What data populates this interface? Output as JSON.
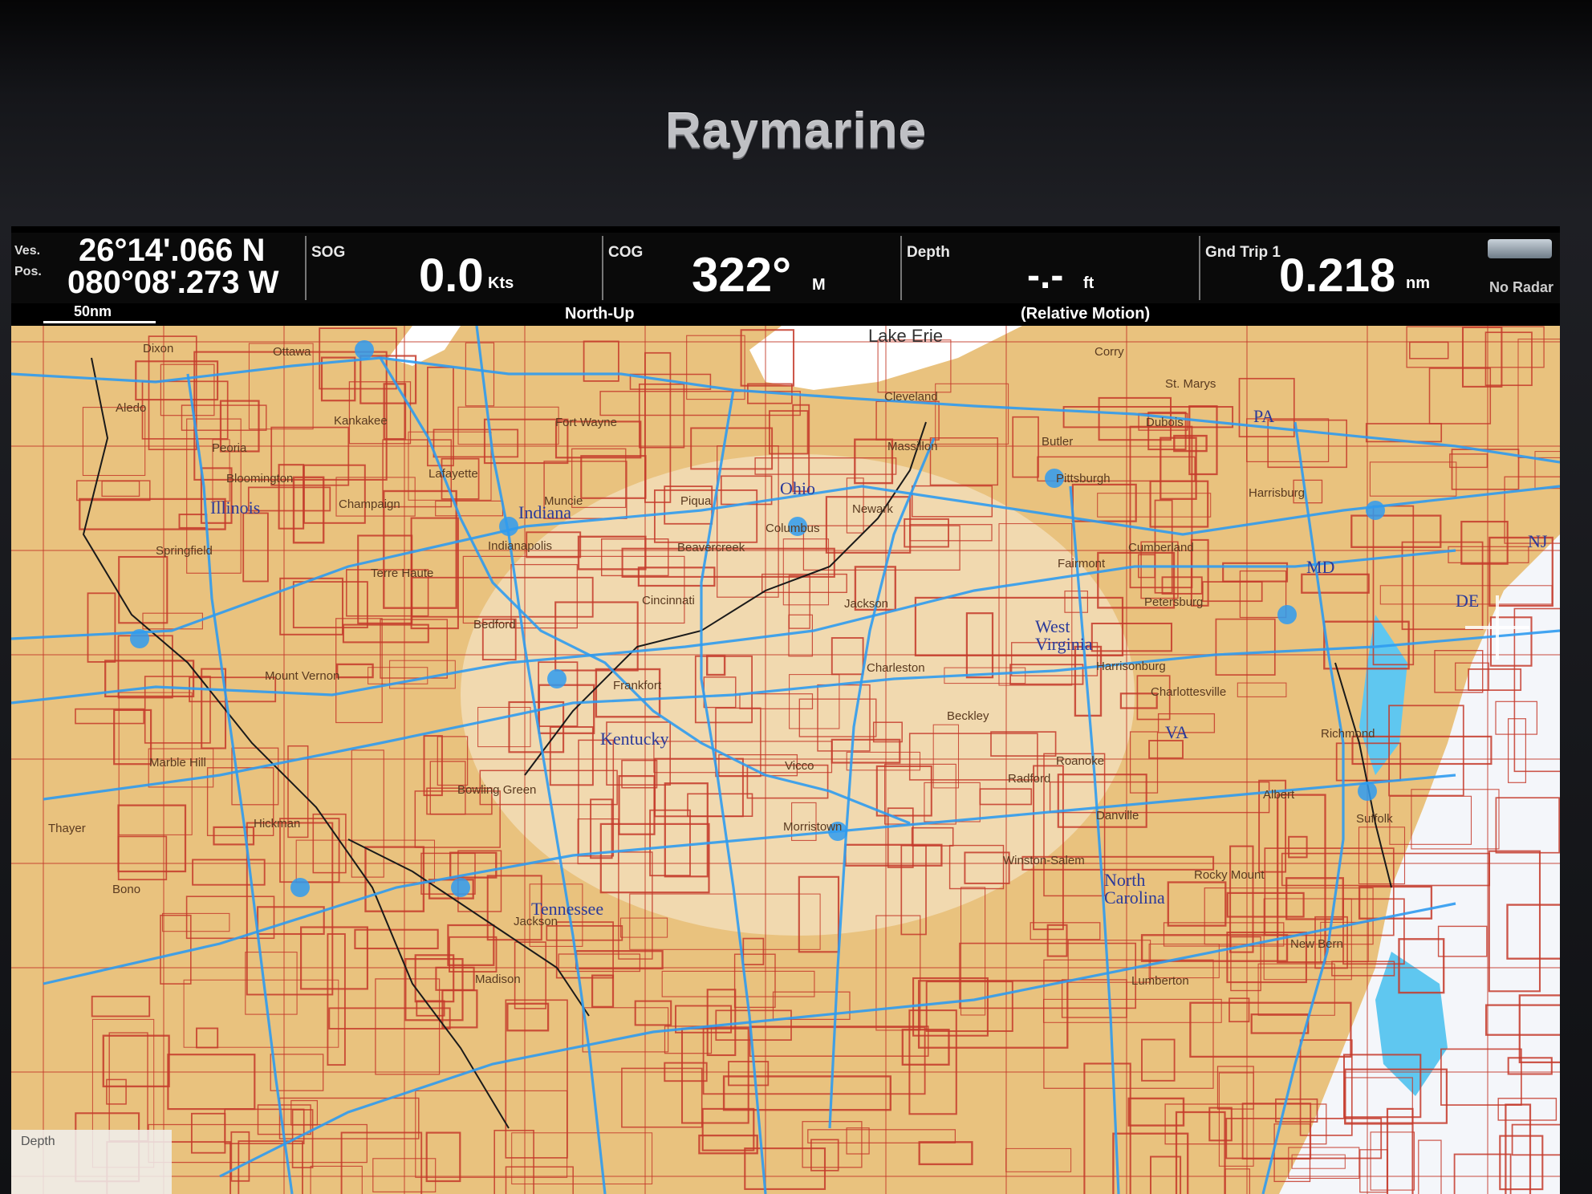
{
  "device": {
    "brand": "Raymarine"
  },
  "databar": {
    "position": {
      "label_top": "Ves.",
      "label_bottom": "Pos.",
      "lat": "26°14'.066 N",
      "lon": "080°08'.273 W"
    },
    "sog": {
      "label": "SOG",
      "value": "0.0",
      "unit": "Kts"
    },
    "cog": {
      "label": "COG",
      "value": "322°",
      "unit": "M"
    },
    "depth": {
      "label": "Depth",
      "value": "-.-",
      "unit": "ft"
    },
    "trip": {
      "label": "Gnd Trip 1",
      "value": "0.218",
      "unit": "nm"
    },
    "radar": {
      "label": "No Radar"
    },
    "orientation": "North-Up",
    "motion_mode": "(Relative Motion)",
    "scale": "50nm"
  },
  "map": {
    "colors": {
      "land": "#e9c27e",
      "grid": "#c43a2a",
      "roads": "#2f9bf0",
      "water": "#ffffff",
      "lake_blue": "#5fc7f0"
    },
    "regions": [
      "Illinois",
      "Indiana",
      "Ohio",
      "Kentucky",
      "West Virginia",
      "Tennessee",
      "North Carolina",
      "PA",
      "MD",
      "VA",
      "DE",
      "NJ"
    ],
    "places": [
      "Lake Erie",
      "Dixon",
      "Ottawa",
      "Aledo",
      "Peoria",
      "Kankakee",
      "Fort Wayne",
      "Lafayette",
      "Bloomington",
      "Champaign",
      "Muncie",
      "Piqua",
      "Newark",
      "Cleveland",
      "Massillon",
      "Butler",
      "Pittsburgh",
      "Corry",
      "St. Marys",
      "Dubois",
      "Harrisburg",
      "Springfield",
      "Terre Haute",
      "Indianapolis",
      "Beavercreek",
      "Columbus",
      "Fairmont",
      "Cumberland",
      "Petersburg",
      "Bedford",
      "Cincinnati",
      "Jackson",
      "Charleston",
      "Harrisonburg",
      "Frankfort",
      "Mount Vernon",
      "Beckley",
      "Charlottesville",
      "Marble Hill",
      "Vicco",
      "Roanoke",
      "Richmond",
      "Bowling Green",
      "Radford",
      "Albert",
      "Hickman",
      "Danville",
      "Suffolk",
      "Thayer",
      "Winston-Salem",
      "Rocky Mount",
      "Bono",
      "Morristown",
      "New Bern",
      "Jackson",
      "Madison",
      "Lumberton",
      "Depth"
    ]
  }
}
